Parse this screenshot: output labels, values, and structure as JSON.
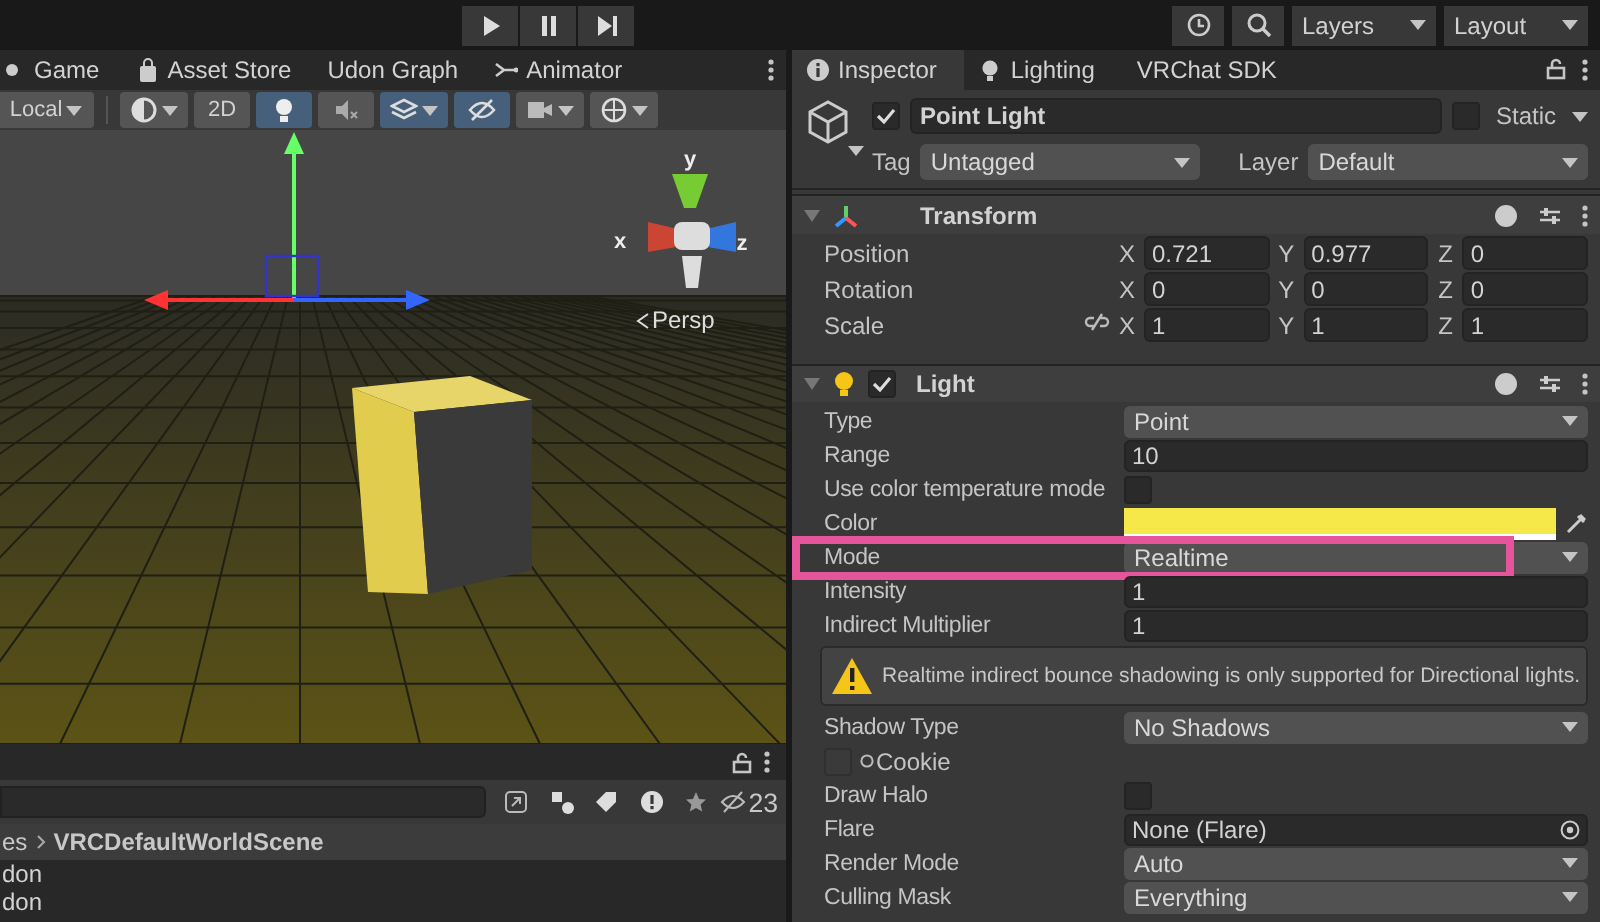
{
  "toolbar": {
    "layers": "Layers",
    "layout": "Layout"
  },
  "scene_tabs": [
    {
      "kind": "game",
      "label": "Game"
    },
    {
      "kind": "store",
      "label": "Asset Store"
    },
    {
      "kind": "none",
      "label": "Udon Graph"
    },
    {
      "kind": "animator",
      "label": "Animator"
    }
  ],
  "scene_toolbar": {
    "pivot": "Local",
    "buttons": [
      {
        "kind": "shading",
        "selected": false
      },
      {
        "kind": "flat",
        "label": "2D",
        "selected": false
      },
      {
        "kind": "lighting",
        "selected": true
      },
      {
        "kind": "audio",
        "selected": false
      },
      {
        "kind": "effects",
        "selected": true
      },
      {
        "kind": "visibility",
        "selected": true
      },
      {
        "kind": "camera",
        "selected": false
      },
      {
        "kind": "gizmos",
        "selected": false
      }
    ]
  },
  "scene": {
    "axes": [
      "y",
      "x",
      "z"
    ],
    "projection": "Persp"
  },
  "project": {
    "hidden_count": "23",
    "breadcrumb": [
      "es",
      "VRCDefaultWorldScene"
    ],
    "rows": [
      "don",
      "don"
    ]
  },
  "inspector_tabs": [
    {
      "kind": "info",
      "label": "Inspector",
      "selected": true
    },
    {
      "kind": "bulb",
      "label": "Lighting",
      "selected": false
    },
    {
      "kind": "none",
      "label": "VRChat SDK",
      "selected": false
    }
  ],
  "object": {
    "active": true,
    "name": "Point Light",
    "static": false,
    "static_label": "Static",
    "tag_label": "Tag",
    "tag": "Untagged",
    "layer_label": "Layer",
    "layer": "Default"
  },
  "transform": {
    "title": "Transform",
    "expanded": true,
    "rows": [
      {
        "label": "Position",
        "link_toggle": false,
        "fields": [
          {
            "axis": "X",
            "value": "0.721"
          },
          {
            "axis": "Y",
            "value": "0.977"
          },
          {
            "axis": "Z",
            "value": "0"
          }
        ]
      },
      {
        "label": "Rotation",
        "link_toggle": false,
        "fields": [
          {
            "axis": "X",
            "value": "0"
          },
          {
            "axis": "Y",
            "value": "0"
          },
          {
            "axis": "Z",
            "value": "0"
          }
        ]
      },
      {
        "label": "Scale",
        "link_toggle": true,
        "fields": [
          {
            "axis": "X",
            "value": "1"
          },
          {
            "axis": "Y",
            "value": "1"
          },
          {
            "axis": "Z",
            "value": "1"
          }
        ]
      }
    ]
  },
  "light": {
    "title": "Light",
    "enabled": true,
    "expanded": true,
    "rows": [
      {
        "kind": "dropdown",
        "label": "Type",
        "value": "Point",
        "highlighted": false
      },
      {
        "kind": "text",
        "label": "Range",
        "value": "10"
      },
      {
        "kind": "checkbox",
        "label": "Use color temperature mode",
        "checked": false
      },
      {
        "kind": "color",
        "label": "Color",
        "color": "#f7e84a"
      },
      {
        "kind": "dropdown",
        "label": "Mode",
        "value": "Realtime",
        "highlighted": true
      },
      {
        "kind": "text",
        "label": "Intensity",
        "value": "1"
      },
      {
        "kind": "text",
        "label": "Indirect Multiplier",
        "value": "1"
      },
      {
        "kind": "warning",
        "text": "Realtime indirect bounce shadowing is only supported for Directional lights."
      },
      {
        "kind": "dropdown",
        "label": "Shadow Type",
        "value": "No Shadows",
        "highlighted": false
      },
      {
        "kind": "texture",
        "label": "Cookie"
      },
      {
        "kind": "checkbox",
        "label": "Draw Halo",
        "checked": false
      },
      {
        "kind": "object",
        "label": "Flare",
        "value": "None (Flare)"
      },
      {
        "kind": "dropdown",
        "label": "Render Mode",
        "value": "Auto",
        "highlighted": false
      },
      {
        "kind": "dropdown",
        "label": "Culling Mask",
        "value": "Everything",
        "highlighted": false
      }
    ]
  }
}
